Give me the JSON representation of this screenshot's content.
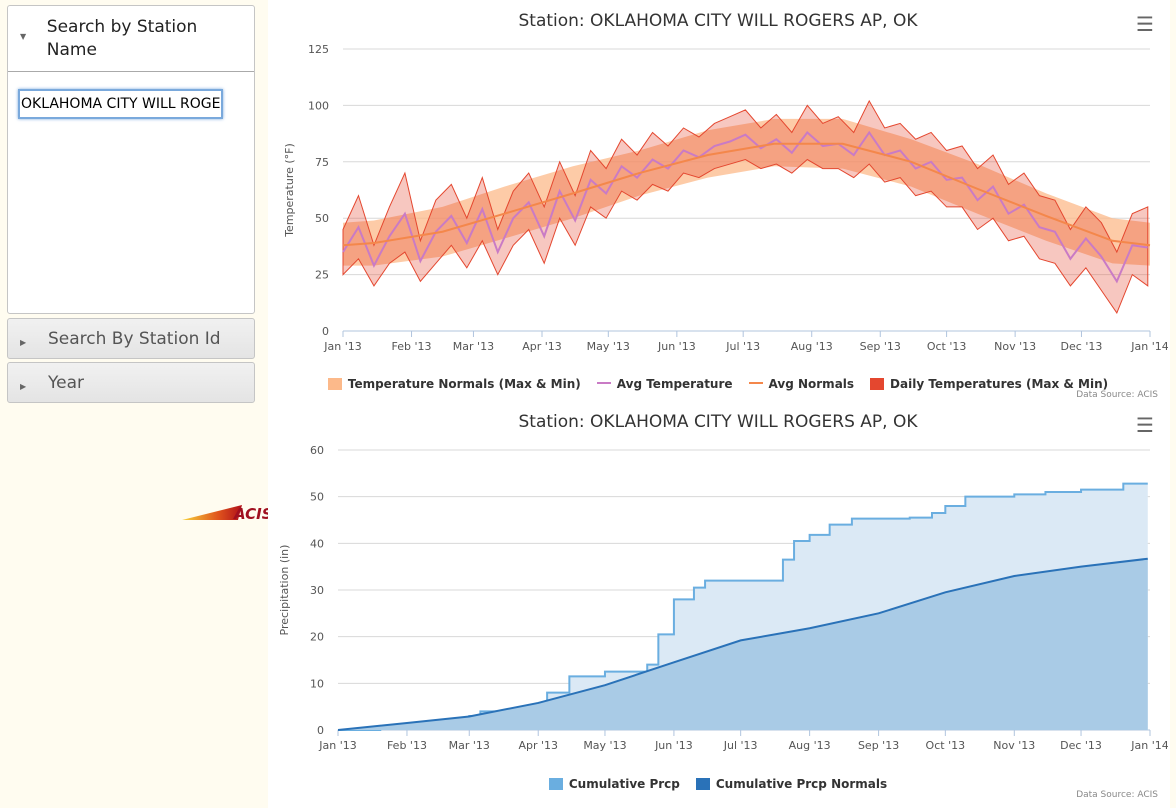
{
  "sidebar": {
    "panels": [
      {
        "label": "Search by Station Name",
        "expanded": true
      },
      {
        "label": "Search By Station Id",
        "expanded": false
      },
      {
        "label": "Year",
        "expanded": false
      }
    ],
    "station_input": {
      "value": "OKLAHOMA CITY WILL ROGERS AP, OK"
    },
    "logo_text": "ACIS"
  },
  "colors": {
    "normals_band": "#fcb98a",
    "avg_temp": "#c97bc5",
    "avg_normals": "#f4874b",
    "daily": "#e4472f",
    "cum_prcp": "#6aaee0",
    "cum_normals": "#2a72b8",
    "page_bg": "#fffcf0"
  },
  "menu_icon": "hamburger-menu-icon",
  "chart_data": [
    {
      "type": "area",
      "title": "Station: OKLAHOMA CITY WILL ROGERS AP, OK",
      "ylabel": "Temperature (°F)",
      "xlabel": "",
      "ylim": [
        0,
        125
      ],
      "yticks": [
        0,
        25,
        50,
        75,
        100,
        125
      ],
      "xticks": [
        "Jan '13",
        "Feb '13",
        "Mar '13",
        "Apr '13",
        "May '13",
        "Jun '13",
        "Jul '13",
        "Aug '13",
        "Sep '13",
        "Oct '13",
        "Nov '13",
        "Dec '13",
        "Jan '14"
      ],
      "grid": true,
      "legend_position": "bottom",
      "source": "Data Source: ACIS",
      "normals": {
        "x": [
          "2013-01-01",
          "2013-01-15",
          "2013-02-15",
          "2013-03-15",
          "2013-04-15",
          "2013-05-15",
          "2013-06-15",
          "2013-07-15",
          "2013-08-15",
          "2013-09-15",
          "2013-10-15",
          "2013-11-15",
          "2013-12-15",
          "2014-01-01"
        ],
        "max": [
          48,
          49,
          55,
          64,
          73,
          80,
          89,
          94,
          94,
          85,
          74,
          61,
          50,
          48
        ],
        "min": [
          29,
          29,
          33,
          41,
          50,
          60,
          68,
          73,
          72,
          64,
          52,
          40,
          30,
          29
        ],
        "avg": [
          38,
          39,
          44,
          52,
          61,
          70,
          78,
          83,
          83,
          75,
          63,
          51,
          40,
          38
        ]
      },
      "daily": {
        "x": [
          "2013-01-01",
          "2013-01-08",
          "2013-01-15",
          "2013-01-22",
          "2013-01-29",
          "2013-02-05",
          "2013-02-12",
          "2013-02-19",
          "2013-02-26",
          "2013-03-05",
          "2013-03-12",
          "2013-03-19",
          "2013-03-26",
          "2013-04-02",
          "2013-04-09",
          "2013-04-16",
          "2013-04-23",
          "2013-04-30",
          "2013-05-07",
          "2013-05-14",
          "2013-05-21",
          "2013-05-28",
          "2013-06-04",
          "2013-06-11",
          "2013-06-18",
          "2013-06-25",
          "2013-07-02",
          "2013-07-09",
          "2013-07-16",
          "2013-07-23",
          "2013-07-30",
          "2013-08-06",
          "2013-08-13",
          "2013-08-20",
          "2013-08-27",
          "2013-09-03",
          "2013-09-10",
          "2013-09-17",
          "2013-09-24",
          "2013-10-01",
          "2013-10-08",
          "2013-10-15",
          "2013-10-22",
          "2013-10-29",
          "2013-11-05",
          "2013-11-12",
          "2013-11-19",
          "2013-11-26",
          "2013-12-03",
          "2013-12-10",
          "2013-12-17",
          "2013-12-24",
          "2013-12-31"
        ],
        "max": [
          45,
          60,
          38,
          55,
          70,
          40,
          58,
          65,
          50,
          68,
          45,
          62,
          70,
          55,
          75,
          60,
          80,
          72,
          85,
          78,
          88,
          82,
          90,
          86,
          92,
          95,
          98,
          90,
          96,
          88,
          100,
          92,
          95,
          88,
          102,
          90,
          92,
          85,
          88,
          80,
          82,
          72,
          78,
          65,
          70,
          60,
          58,
          45,
          55,
          48,
          35,
          52,
          55
        ],
        "min": [
          25,
          32,
          20,
          30,
          35,
          22,
          30,
          38,
          28,
          40,
          25,
          38,
          45,
          30,
          50,
          38,
          55,
          50,
          62,
          58,
          65,
          62,
          70,
          68,
          72,
          74,
          76,
          72,
          74,
          70,
          76,
          72,
          72,
          68,
          74,
          66,
          68,
          60,
          62,
          55,
          55,
          45,
          50,
          40,
          42,
          32,
          30,
          20,
          28,
          18,
          8,
          25,
          20
        ],
        "avg": [
          35,
          46,
          29,
          42,
          52,
          31,
          44,
          51,
          39,
          54,
          35,
          50,
          57,
          42,
          62,
          49,
          67,
          61,
          73,
          68,
          76,
          72,
          80,
          77,
          82,
          84,
          87,
          81,
          85,
          79,
          88,
          82,
          83,
          78,
          88,
          78,
          80,
          72,
          75,
          67,
          68,
          58,
          64,
          52,
          56,
          46,
          44,
          32,
          41,
          33,
          22,
          38,
          37
        ]
      },
      "series_names": [
        "Temperature Normals (Max & Min)",
        "Avg Temperature",
        "Avg Normals",
        "Daily Temperatures (Max & Min)"
      ]
    },
    {
      "type": "area",
      "title": "Station: OKLAHOMA CITY WILL ROGERS AP, OK",
      "ylabel": "Precipitation (in)",
      "xlabel": "",
      "ylim": [
        0,
        60
      ],
      "yticks": [
        0,
        10,
        20,
        30,
        40,
        50,
        60
      ],
      "xticks": [
        "Jan '13",
        "Feb '13",
        "Mar '13",
        "Apr '13",
        "May '13",
        "Jun '13",
        "Jul '13",
        "Aug '13",
        "Sep '13",
        "Oct '13",
        "Nov '13",
        "Dec '13",
        "Jan '14"
      ],
      "grid": true,
      "legend_position": "bottom",
      "source": "Data Source: ACIS",
      "series": [
        {
          "name": "Cumulative Prcp",
          "step": true,
          "x": [
            "2013-01-01",
            "2013-01-20",
            "2013-02-01",
            "2013-02-20",
            "2013-03-01",
            "2013-03-06",
            "2013-03-20",
            "2013-04-01",
            "2013-04-05",
            "2013-04-15",
            "2013-05-01",
            "2013-05-20",
            "2013-05-25",
            "2013-06-01",
            "2013-06-10",
            "2013-06-15",
            "2013-07-01",
            "2013-07-20",
            "2013-07-25",
            "2013-08-01",
            "2013-08-10",
            "2013-08-20",
            "2013-09-01",
            "2013-09-15",
            "2013-09-25",
            "2013-10-01",
            "2013-10-10",
            "2013-11-01",
            "2013-11-15",
            "2013-12-01",
            "2013-12-20",
            "2013-12-31"
          ],
          "y": [
            0,
            0.5,
            1.0,
            2.0,
            3.0,
            4.0,
            4.3,
            4.5,
            8.0,
            11.5,
            12.5,
            14.0,
            20.5,
            28.0,
            30.5,
            32.0,
            32.0,
            36.5,
            40.5,
            41.8,
            44.0,
            45.3,
            45.3,
            45.5,
            46.5,
            48.0,
            50.0,
            50.5,
            51.0,
            51.5,
            52.8,
            52.8
          ]
        },
        {
          "name": "Cumulative Prcp Normals",
          "step": false,
          "x": [
            "2013-01-01",
            "2013-02-01",
            "2013-03-01",
            "2013-04-01",
            "2013-05-01",
            "2013-06-01",
            "2013-07-01",
            "2013-08-01",
            "2013-09-01",
            "2013-10-01",
            "2013-11-01",
            "2013-12-01",
            "2013-12-31"
          ],
          "y": [
            0,
            1.5,
            2.9,
            5.8,
            9.6,
            14.5,
            19.2,
            21.8,
            25.0,
            29.5,
            33.0,
            35.0,
            36.7
          ]
        }
      ]
    }
  ]
}
